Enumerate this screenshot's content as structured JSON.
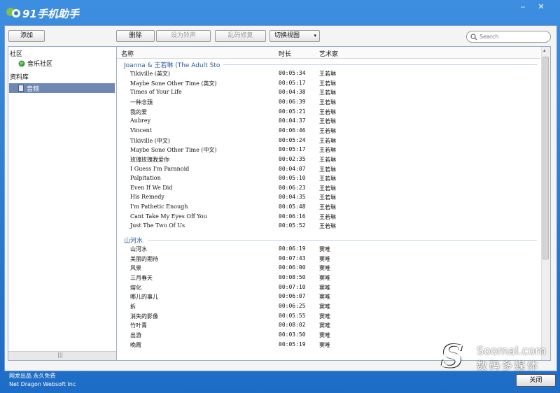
{
  "app": {
    "title": "91手机助手"
  },
  "toolbar": {
    "add": "添加",
    "delete": "删除",
    "set_ringtone": "设为铃声",
    "fix_garbled": "乱码修复",
    "switch_view": "切换视图",
    "search_placeholder": "Search"
  },
  "sidebar": {
    "community_header": "社区",
    "music_community": "音乐社区",
    "library_header": "资料库",
    "audio": "音频"
  },
  "table": {
    "col_name": "名称",
    "col_duration": "时长",
    "col_artist": "艺术家",
    "groups": [
      {
        "title": "Joanna & 王若琳 (The Adult Sto",
        "rows": [
          {
            "name": "Tikiville (英文)",
            "duration": "00:05:34",
            "artist": "王若琳"
          },
          {
            "name": "Maybe Sone Other Time (英文)",
            "duration": "00:05:17",
            "artist": "王若琳"
          },
          {
            "name": "Times of Your Life",
            "duration": "00:04:38",
            "artist": "王若琳"
          },
          {
            "name": "一种念頭",
            "duration": "00:06:39",
            "artist": "王若琳"
          },
          {
            "name": "我的爱",
            "duration": "00:05:21",
            "artist": "王若琳"
          },
          {
            "name": "Aubrey",
            "duration": "00:04:37",
            "artist": "王若琳"
          },
          {
            "name": "Vincent",
            "duration": "00:06:46",
            "artist": "王若琳"
          },
          {
            "name": "Tikiville (中文)",
            "duration": "00:05:24",
            "artist": "王若琳"
          },
          {
            "name": "Maybe Sone Other Time (中文)",
            "duration": "00:05:17",
            "artist": "王若琳"
          },
          {
            "name": "玫瑰玫瑰我爱你",
            "duration": "00:02:35",
            "artist": "王若琳"
          },
          {
            "name": "I Guess I'm Paranoid",
            "duration": "00:04:07",
            "artist": "王若琳"
          },
          {
            "name": "Palpitation",
            "duration": "00:05:10",
            "artist": "王若琳"
          },
          {
            "name": "Even If We Did",
            "duration": "00:06:23",
            "artist": "王若琳"
          },
          {
            "name": "His Remedy",
            "duration": "00:04:35",
            "artist": "王若琳"
          },
          {
            "name": "I'm Pathetic Enough",
            "duration": "00:05:48",
            "artist": "王若琳"
          },
          {
            "name": "Cant Take My Eyes Off You",
            "duration": "00:06:16",
            "artist": "王若琳"
          },
          {
            "name": "Just The Two Of Us",
            "duration": "00:05:52",
            "artist": "王若琳"
          }
        ]
      },
      {
        "title": "山河水",
        "rows": [
          {
            "name": "山河水",
            "duration": "00:06:19",
            "artist": "窦唯"
          },
          {
            "name": "美丽的期待",
            "duration": "00:07:43",
            "artist": "窦唯"
          },
          {
            "name": "风景",
            "duration": "00:06:00",
            "artist": "窦唯"
          },
          {
            "name": "三月春天",
            "duration": "00:08:50",
            "artist": "窦唯"
          },
          {
            "name": "熔化",
            "duration": "00:07:10",
            "artist": "窦唯"
          },
          {
            "name": "哪儿的事儿",
            "duration": "00:06:07",
            "artist": "窦唯"
          },
          {
            "name": "拆",
            "duration": "00:06:25",
            "artist": "窦唯"
          },
          {
            "name": "消失的影像",
            "duration": "00:05:55",
            "artist": "窦唯"
          },
          {
            "name": "竹叶青",
            "duration": "00:08:02",
            "artist": "窦唯"
          },
          {
            "name": "出游",
            "duration": "00:03:50",
            "artist": "窦唯"
          },
          {
            "name": "晚霞",
            "duration": "00:05:19",
            "artist": "窦唯"
          }
        ]
      }
    ]
  },
  "footer": {
    "line1": "网龙出品 永久免费",
    "line2": "Net Dragon Websoft Inc",
    "close": "关闭"
  },
  "watermark": {
    "line1": "Soomal.com",
    "line2": "数码多媒体"
  }
}
